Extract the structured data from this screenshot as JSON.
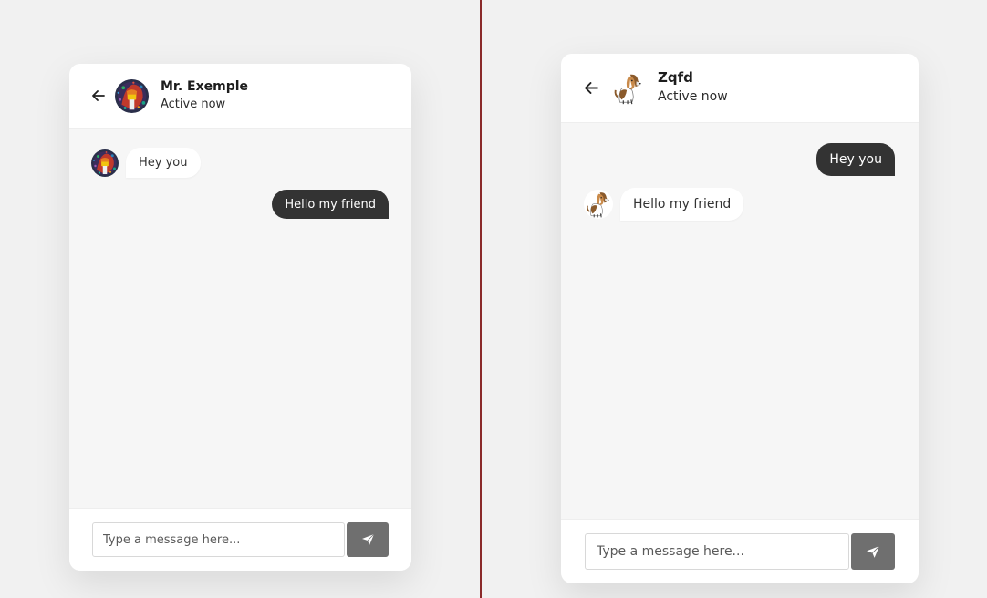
{
  "left_chat": {
    "header": {
      "back_icon": "arrow-left-icon",
      "avatar": "abstract-colorful-avatar",
      "name": "Mr. Exemple",
      "status": "Active now"
    },
    "messages": [
      {
        "direction": "incoming",
        "text": "Hey you",
        "avatar": "abstract-colorful-avatar"
      },
      {
        "direction": "outgoing",
        "text": "Hello my friend"
      }
    ],
    "composer": {
      "placeholder": "Type a message here...",
      "value": "",
      "send_icon": "paper-plane-icon"
    }
  },
  "right_chat": {
    "header": {
      "back_icon": "arrow-left-icon",
      "avatar": "beagle-dog-avatar",
      "name": "Zqfd",
      "status": "Active now"
    },
    "messages": [
      {
        "direction": "outgoing",
        "text": "Hey you"
      },
      {
        "direction": "incoming",
        "text": "Hello my friend",
        "avatar": "beagle-dog-avatar"
      }
    ],
    "composer": {
      "placeholder": "Type a message here...",
      "value": "",
      "send_icon": "paper-plane-icon"
    }
  },
  "colors": {
    "page_background": "#f1f1f1",
    "chat_background": "#f6f6f6",
    "outgoing_bubble": "#333333",
    "incoming_bubble": "#ffffff",
    "send_button": "#6f6f6f",
    "divider": "#8a2a2a"
  }
}
